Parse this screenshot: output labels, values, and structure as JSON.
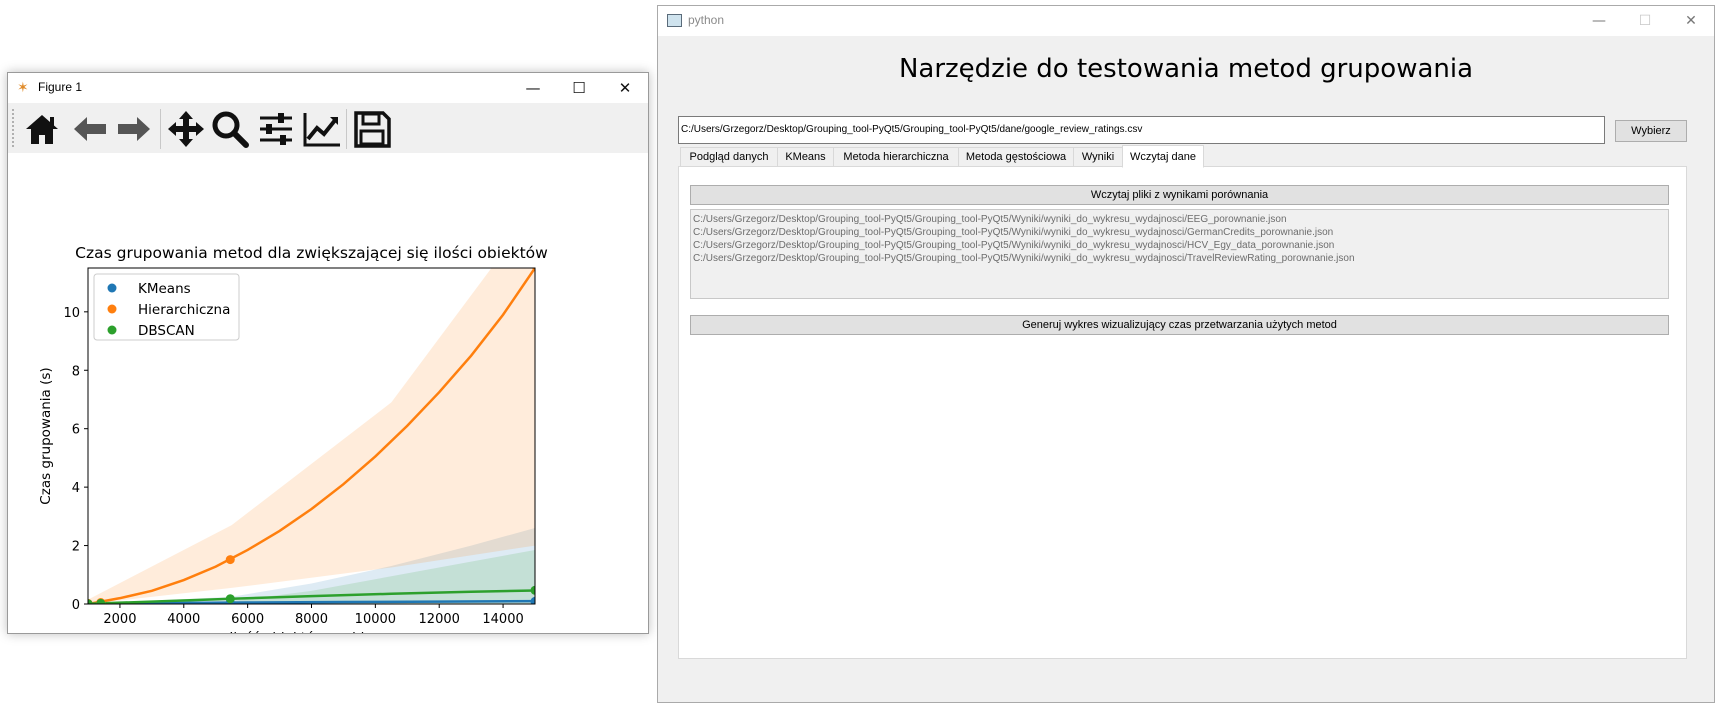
{
  "figure_window": {
    "title": "Figure 1",
    "minimize": "—",
    "maximize": "☐",
    "close": "✕",
    "toolbar": [
      "home-icon",
      "back-arrow-icon",
      "forward-arrow-icon",
      "pan-move-icon",
      "zoom-magnifier-icon",
      "configure-subplots-icon",
      "edit-axis-icon",
      "save-floppy-icon"
    ]
  },
  "chart_data": {
    "type": "line",
    "title": "Czas grupowania metod dla zwiększającej się ilości obiektów",
    "xlabel": "Ilość obiektów w zbiorze",
    "ylabel": "Czas grupowania (s)",
    "xlim": [
      1000,
      15000
    ],
    "ylim": [
      0,
      11.5
    ],
    "x_ticks": [
      2000,
      4000,
      6000,
      8000,
      10000,
      12000,
      14000
    ],
    "y_ticks": [
      0,
      2,
      4,
      6,
      8,
      10
    ],
    "legend_position": "top-left",
    "series": [
      {
        "name": "KMeans",
        "color": "#1f77b4",
        "points": [
          [
            1000,
            0.01
          ],
          [
            1400,
            0.015
          ],
          [
            5456,
            0.04
          ],
          [
            15000,
            0.09
          ]
        ],
        "curve": [
          [
            1000,
            0.0
          ],
          [
            3000,
            0.03
          ],
          [
            6000,
            0.05
          ],
          [
            9000,
            0.07
          ],
          [
            12000,
            0.08
          ],
          [
            15000,
            0.1
          ]
        ],
        "band_upper": [
          [
            1000,
            0.0
          ],
          [
            5500,
            0.25
          ],
          [
            8000,
            0.7
          ],
          [
            10500,
            1.3
          ],
          [
            13000,
            2.0
          ],
          [
            15000,
            2.6
          ]
        ],
        "band_lower": [
          [
            1000,
            0.0
          ],
          [
            15000,
            0.0
          ]
        ]
      },
      {
        "name": "Hierarchiczna",
        "color": "#ff7f0e",
        "points": [
          [
            1000,
            0.02
          ],
          [
            1400,
            0.05
          ],
          [
            5456,
            1.52
          ],
          [
            15000,
            11.6
          ]
        ],
        "curve": [
          [
            1000,
            0.0
          ],
          [
            2000,
            0.2
          ],
          [
            3000,
            0.45
          ],
          [
            4000,
            0.82
          ],
          [
            5000,
            1.28
          ],
          [
            6000,
            1.85
          ],
          [
            7000,
            2.5
          ],
          [
            8000,
            3.25
          ],
          [
            9000,
            4.1
          ],
          [
            10000,
            5.05
          ],
          [
            11000,
            6.1
          ],
          [
            12000,
            7.25
          ],
          [
            13000,
            8.5
          ],
          [
            14000,
            9.9
          ],
          [
            15000,
            11.5
          ]
        ],
        "band_upper": [
          [
            1000,
            0.15
          ],
          [
            5500,
            2.7
          ],
          [
            10500,
            6.9
          ],
          [
            15000,
            13.5
          ]
        ],
        "band_lower": [
          [
            1000,
            0.0
          ],
          [
            5500,
            0.55
          ],
          [
            10500,
            1.25
          ],
          [
            15000,
            2.0
          ]
        ]
      },
      {
        "name": "DBSCAN",
        "color": "#2ca02c",
        "points": [
          [
            1000,
            0.01
          ],
          [
            1400,
            0.02
          ],
          [
            5456,
            0.18
          ],
          [
            15000,
            0.47
          ]
        ],
        "curve": [
          [
            1000,
            0.01
          ],
          [
            3000,
            0.08
          ],
          [
            5500,
            0.18
          ],
          [
            8000,
            0.27
          ],
          [
            10500,
            0.35
          ],
          [
            13000,
            0.42
          ],
          [
            15000,
            0.46
          ]
        ],
        "band_upper": [
          [
            1000,
            0.0
          ],
          [
            5500,
            0.1
          ],
          [
            8000,
            0.45
          ],
          [
            10500,
            0.95
          ],
          [
            13000,
            1.45
          ],
          [
            15000,
            1.85
          ]
        ],
        "band_lower": [
          [
            1000,
            0.0
          ],
          [
            15000,
            0.0
          ]
        ]
      }
    ]
  },
  "qt_window": {
    "title": "python",
    "minimize": "—",
    "maximize": "☐",
    "close": "✕",
    "heading": "Narzędzie do testowania metod grupowania",
    "path_value": "C:/Users/Grzegorz/Desktop/Grouping_tool-PyQt5/Grouping_tool-PyQt5/dane/google_review_ratings.csv",
    "choose_button": "Wybierz",
    "tabs": [
      "Podgląd danych",
      "KMeans",
      "Metoda hierarchiczna",
      "Metoda gęstościowa",
      "Wyniki",
      "Wczytaj dane"
    ],
    "active_tab": "Wczytaj dane",
    "load_files_button": "Wczytaj pliki z wynikami porównania",
    "files": [
      "C:/Users/Grzegorz/Desktop/Grouping_tool-PyQt5/Grouping_tool-PyQt5/Wyniki/wyniki_do_wykresu_wydajnosci/EEG_porownanie.json",
      "C:/Users/Grzegorz/Desktop/Grouping_tool-PyQt5/Grouping_tool-PyQt5/Wyniki/wyniki_do_wykresu_wydajnosci/GermanCredits_porownanie.json",
      "C:/Users/Grzegorz/Desktop/Grouping_tool-PyQt5/Grouping_tool-PyQt5/Wyniki/wyniki_do_wykresu_wydajnosci/HCV_Egy_data_porownanie.json",
      "C:/Users/Grzegorz/Desktop/Grouping_tool-PyQt5/Grouping_tool-PyQt5/Wyniki/wyniki_do_wykresu_wydajnosci/TravelReviewRating_porownanie.json"
    ],
    "generate_button": "Generuj wykres wizualizujący czas przetwarzania użytych metod"
  }
}
